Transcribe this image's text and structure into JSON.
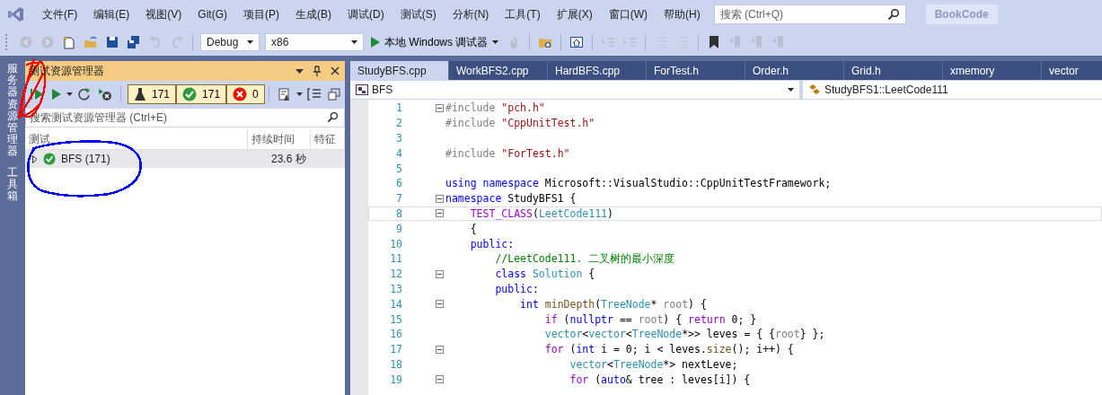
{
  "menu_bar": {
    "items": [
      "文件(F)",
      "编辑(E)",
      "视图(V)",
      "Git(G)",
      "项目(P)",
      "生成(B)",
      "调试(D)",
      "测试(S)",
      "分析(N)",
      "工具(T)",
      "扩展(X)",
      "窗口(W)",
      "帮助(H)"
    ],
    "search": {
      "placeholder": "搜索 (Ctrl+Q)"
    },
    "solution_name": "BookCode"
  },
  "toolbar": {
    "items": [
      {
        "kind": "back",
        "disabled": true
      },
      {
        "kind": "forward",
        "disabled": true
      },
      {
        "kind": "new_item",
        "disabled": false
      },
      {
        "kind": "open",
        "disabled": false
      },
      {
        "kind": "save",
        "disabled": false
      },
      {
        "kind": "save_all",
        "disabled": false
      },
      {
        "kind": "undo",
        "disabled": true
      },
      {
        "kind": "redo",
        "disabled": true
      },
      {
        "kind": "config",
        "value": "Debug"
      },
      {
        "kind": "platform",
        "value": "x86"
      },
      {
        "kind": "run",
        "label": "本地 Windows 调试器"
      },
      {
        "kind": "hot_reload",
        "disabled": true
      },
      {
        "kind": "find_folder",
        "disabled": false
      },
      {
        "kind": "window",
        "disabled": false
      },
      {
        "kind": "indent",
        "disabled": true
      },
      {
        "kind": "outdent",
        "disabled": true
      },
      {
        "kind": "comment",
        "disabled": true
      },
      {
        "kind": "uncomment",
        "disabled": true
      },
      {
        "kind": "bookmark",
        "disabled": false
      },
      {
        "kind": "prev_bookmark",
        "disabled": true
      },
      {
        "kind": "next_bookmark",
        "disabled": true
      },
      {
        "kind": "clear_bookmark",
        "disabled": true
      }
    ]
  },
  "side_tabs": [
    "服务器资源管理器",
    "工具箱"
  ],
  "test_explorer": {
    "title": "测试资源管理器",
    "counts": [
      {
        "kind": "total",
        "count": "171"
      },
      {
        "kind": "passed",
        "count": "171"
      },
      {
        "kind": "failed",
        "count": "0"
      }
    ],
    "search": {
      "placeholder": "搜索测试资源管理器 (Ctrl+E)"
    },
    "columns": [
      "测试",
      "持续时间",
      "特征"
    ],
    "rows": [
      {
        "name": "BFS (171)",
        "duration": "23.6 秒",
        "kind": "passed",
        "expanded": false,
        "selected": true
      }
    ]
  },
  "editor": {
    "tabs": [
      {
        "label": "StudyBFS.cpp",
        "selected": true
      },
      {
        "label": "WorkBFS2.cpp",
        "selected": false
      },
      {
        "label": "HardBFS.cpp",
        "selected": false
      },
      {
        "label": "ForTest.h",
        "selected": false
      },
      {
        "label": "Order.h",
        "selected": false
      },
      {
        "label": "Grid.h",
        "selected": false
      },
      {
        "label": "xmemory",
        "selected": false
      },
      {
        "label": "vector",
        "selected": false
      }
    ],
    "scope": "BFS",
    "member": "StudyBFS1::LeetCode111",
    "lines": [
      {
        "number": "1",
        "fold": true,
        "current": false,
        "tokens": [
          {
            "kind": "pre",
            "t": "#include"
          },
          {
            "kind": "str",
            "t": " \"pch.h\""
          }
        ]
      },
      {
        "number": "2",
        "fold": false,
        "current": false,
        "tokens": [
          {
            "kind": "pre",
            "t": "#include"
          },
          {
            "kind": "str",
            "t": " \"CppUnitTest.h\""
          }
        ]
      },
      {
        "number": "3",
        "fold": false,
        "current": false
      },
      {
        "number": "4",
        "fold": false,
        "current": false,
        "tokens": [
          {
            "kind": "pre",
            "t": "#include"
          },
          {
            "kind": "str",
            "t": " \"ForTest.h\""
          }
        ]
      },
      {
        "number": "5",
        "fold": false,
        "current": false
      },
      {
        "number": "6",
        "fold": false,
        "current": false,
        "tokens": [
          {
            "kind": "kw",
            "t": "using namespace"
          },
          {
            "kind": "plain",
            "t": " Microsoft::VisualStudio::CppUnitTestFramework;"
          }
        ]
      },
      {
        "number": "7",
        "fold": true,
        "current": false,
        "tokens": [
          {
            "kind": "kw",
            "t": "namespace"
          },
          {
            "kind": "plain",
            "t": " StudyBFS1 {"
          }
        ]
      },
      {
        "number": "8",
        "fold": true,
        "current": true,
        "tokens": [
          {
            "kind": "macro",
            "t": "    TEST_CLASS"
          },
          {
            "kind": "plain",
            "t": "("
          },
          {
            "kind": "type",
            "t": "LeetCode111"
          },
          {
            "kind": "plain",
            "t": ")"
          }
        ]
      },
      {
        "number": "9",
        "fold": false,
        "current": false,
        "tokens": [
          {
            "kind": "plain",
            "t": "    {"
          }
        ]
      },
      {
        "number": "10",
        "fold": false,
        "current": false,
        "tokens": [
          {
            "kind": "kw",
            "t": "    public"
          },
          {
            "kind": "plain",
            "t": ":"
          }
        ]
      },
      {
        "number": "11",
        "fold": false,
        "current": false,
        "tokens": [
          {
            "kind": "cmt",
            "t": "        //LeetCode111. 二叉树的最小深度"
          }
        ]
      },
      {
        "number": "12",
        "fold": true,
        "current": false,
        "tokens": [
          {
            "kind": "kw",
            "t": "        class"
          },
          {
            "kind": "type",
            "t": " Solution"
          },
          {
            "kind": "plain",
            "t": " {"
          }
        ]
      },
      {
        "number": "13",
        "fold": false,
        "current": false,
        "tokens": [
          {
            "kind": "kw",
            "t": "        public"
          },
          {
            "kind": "plain",
            "t": ":"
          }
        ]
      },
      {
        "number": "14",
        "fold": true,
        "current": false,
        "tokens": [
          {
            "kind": "kw",
            "t": "            int"
          },
          {
            "kind": "fn",
            "t": " minDepth"
          },
          {
            "kind": "plain",
            "t": "("
          },
          {
            "kind": "type",
            "t": "TreeNode"
          },
          {
            "kind": "plain",
            "t": "* "
          },
          {
            "kind": "param",
            "t": "root"
          },
          {
            "kind": "plain",
            "t": ") {"
          }
        ]
      },
      {
        "number": "15",
        "fold": false,
        "current": false,
        "tokens": [
          {
            "kind": "ctl",
            "t": "                if"
          },
          {
            "kind": "plain",
            "t": " ("
          },
          {
            "kind": "kw",
            "t": "nullptr"
          },
          {
            "kind": "plain",
            "t": " == "
          },
          {
            "kind": "param",
            "t": "root"
          },
          {
            "kind": "plain",
            "t": ") { "
          },
          {
            "kind": "ctl",
            "t": "return"
          },
          {
            "kind": "plain",
            "t": " 0; }"
          }
        ]
      },
      {
        "number": "16",
        "fold": false,
        "current": false,
        "tokens": [
          {
            "kind": "type",
            "t": "                vector"
          },
          {
            "kind": "plain",
            "t": "<"
          },
          {
            "kind": "type",
            "t": "vector"
          },
          {
            "kind": "plain",
            "t": "<"
          },
          {
            "kind": "type",
            "t": "TreeNode"
          },
          {
            "kind": "plain",
            "t": "*>> leves = { {"
          },
          {
            "kind": "param",
            "t": "root"
          },
          {
            "kind": "plain",
            "t": "} };"
          }
        ]
      },
      {
        "number": "17",
        "fold": true,
        "current": false,
        "tokens": [
          {
            "kind": "ctl",
            "t": "                for"
          },
          {
            "kind": "plain",
            "t": " ("
          },
          {
            "kind": "kw",
            "t": "int"
          },
          {
            "kind": "plain",
            "t": " i = 0; i < leves."
          },
          {
            "kind": "fn",
            "t": "size"
          },
          {
            "kind": "plain",
            "t": "(); i++) {"
          }
        ]
      },
      {
        "number": "18",
        "fold": false,
        "current": false,
        "tokens": [
          {
            "kind": "type",
            "t": "                    vector"
          },
          {
            "kind": "plain",
            "t": "<"
          },
          {
            "kind": "type",
            "t": "TreeNode"
          },
          {
            "kind": "plain",
            "t": "*> nextLeve;"
          }
        ]
      },
      {
        "number": "19",
        "fold": true,
        "current": false,
        "tokens": [
          {
            "kind": "ctl",
            "t": "                    for"
          },
          {
            "kind": "plain",
            "t": " ("
          },
          {
            "kind": "kw",
            "t": "auto"
          },
          {
            "kind": "plain",
            "t": "& tree : leves[i]) {"
          }
        ]
      }
    ]
  },
  "annotations": [
    {
      "kind": "scribble",
      "color": "#ff0000"
    },
    {
      "kind": "ellipse",
      "color": "#0000ff"
    }
  ]
}
